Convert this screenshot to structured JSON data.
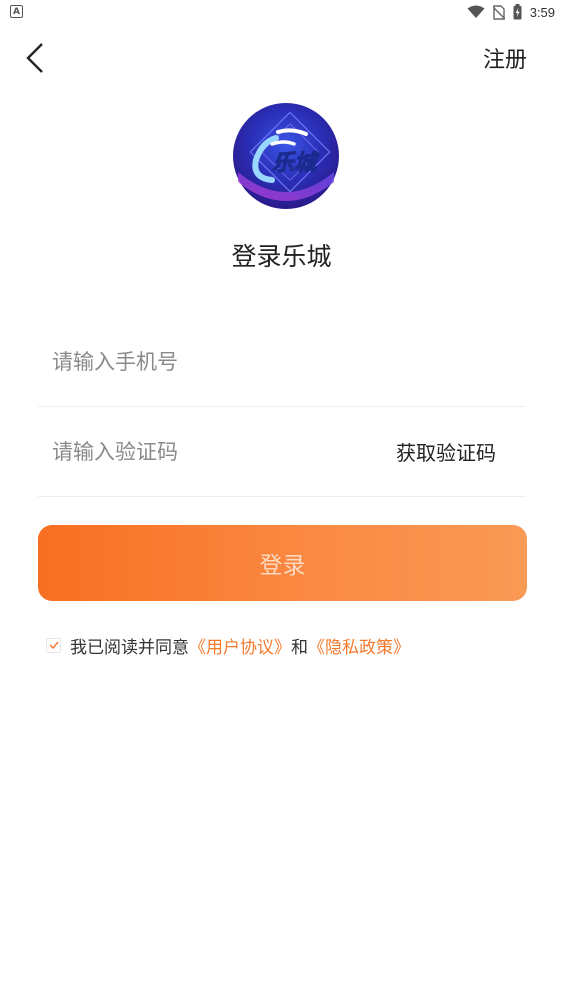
{
  "status_bar": {
    "left_badge": "A",
    "time": "3:59",
    "icons": [
      "wifi-icon",
      "no-sim-icon",
      "battery-icon"
    ]
  },
  "top_bar": {
    "back_icon": "chevron-left-icon",
    "register_label": "注册"
  },
  "logo": {
    "text": "乐城"
  },
  "title": "登录乐城",
  "form": {
    "phone_placeholder": "请输入手机号",
    "phone_value": "",
    "code_placeholder": "请输入验证码",
    "code_value": "",
    "get_code_label": "获取验证码"
  },
  "login_button_label": "登录",
  "agreement": {
    "checked": true,
    "prefix": "我已阅读并同意",
    "user_agreement": "《用户协议》",
    "conjunction": "和",
    "privacy_policy": "《隐私政策》"
  },
  "colors": {
    "accent": "#f47a2e",
    "button_gradient_start": "#f86f21",
    "button_gradient_end": "#f99a55",
    "button_text": "#ffd9c0"
  }
}
